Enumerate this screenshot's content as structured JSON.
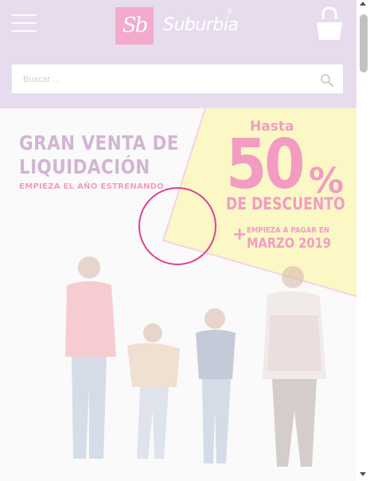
{
  "header": {
    "menu_icon": "hamburger-menu-icon",
    "logo_monogram": "Sb",
    "logo_text": "Suburbia",
    "logo_registered": "®",
    "cart_icon": "shopping-bag-icon",
    "background_color": "#e7dcee"
  },
  "search": {
    "placeholder": "Buscar ...",
    "value": "",
    "icon": "search-icon"
  },
  "banner": {
    "headline_line1": "GRAN VENTA DE",
    "headline_line2": "LIQUIDACIÓN",
    "subheadline": "EMPIEZA EL AÑO ESTRENANDO",
    "hasta": "Hasta",
    "discount_number": "50",
    "discount_percent": "%",
    "discount_label": "DE DESCUENTO",
    "plus_sign": "+",
    "payment_line1": "EMPIEZA A PAGAR EN",
    "payment_line2": "MARZO 2019",
    "accent_pink": "#f39cc2",
    "headline_color": "#d3b4d5",
    "promo_yellow": "#fbf8c6"
  },
  "tap_indicator": {
    "color": "#e0408f"
  },
  "scrollbar": {
    "up_icon": "scroll-up-arrow-icon",
    "down_icon": "scroll-down-arrow-icon"
  }
}
